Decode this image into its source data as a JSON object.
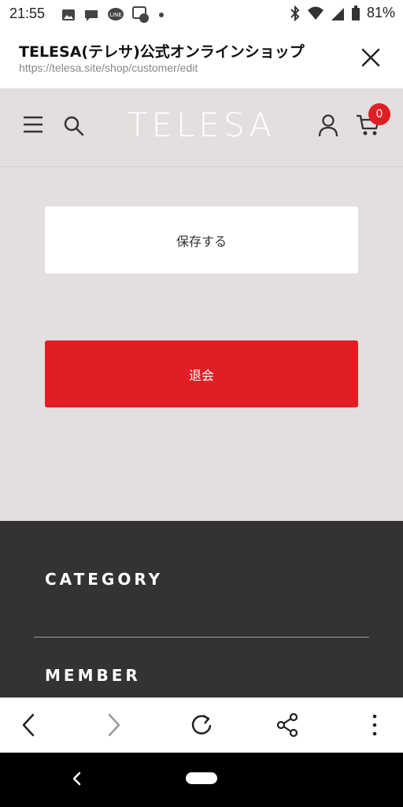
{
  "status_bar": {
    "time": "21:55",
    "battery": "81%"
  },
  "tab": {
    "title": "TELESA(テレサ)公式オンラインショップ",
    "url": "https://telesa.site/shop/customer/edit"
  },
  "header": {
    "logo": "TELESA",
    "cart_count": "0"
  },
  "main": {
    "save_label": "保存する",
    "withdraw_label": "退会"
  },
  "footer": {
    "category": "CATEGORY",
    "member": "MEMBER"
  },
  "colors": {
    "accent": "#e01e26",
    "page_bg": "#e3dfde",
    "footer_bg": "#343232"
  }
}
